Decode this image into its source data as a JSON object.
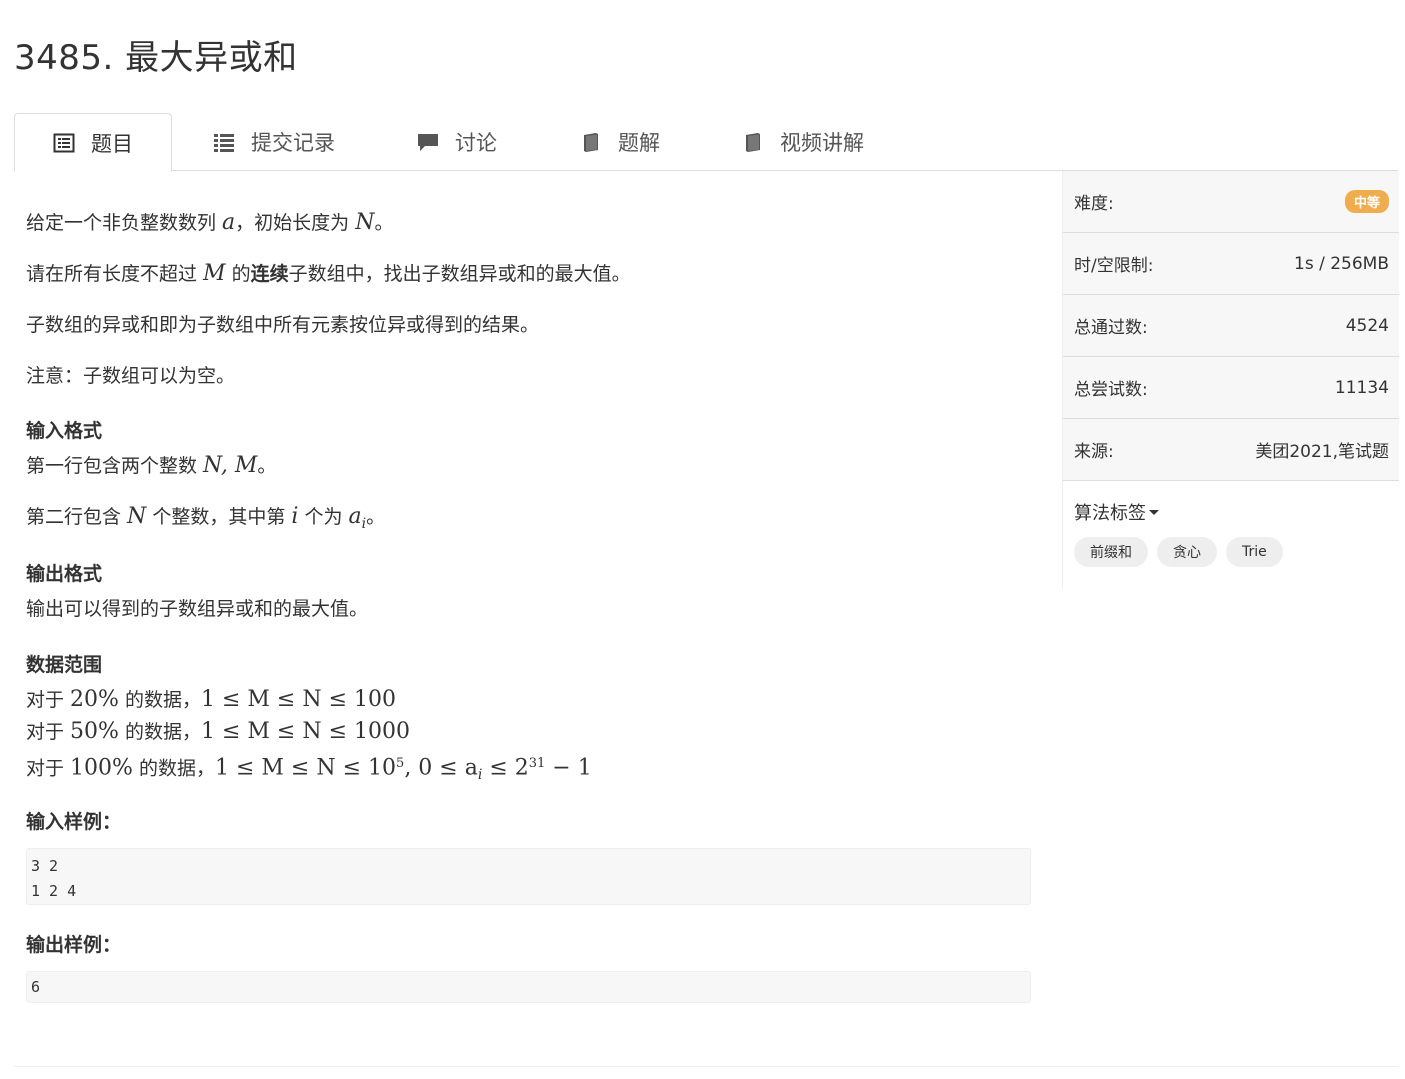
{
  "problem": {
    "title": "3485. 最大异或和"
  },
  "tabs": [
    {
      "label": "题目",
      "icon": "list-alt-icon"
    },
    {
      "label": "提交记录",
      "icon": "list-icon"
    },
    {
      "label": "讨论",
      "icon": "comment-icon"
    },
    {
      "label": "题解",
      "icon": "book-icon"
    },
    {
      "label": "视频讲解",
      "icon": "book-icon"
    }
  ],
  "content": {
    "p1_pre": "给定一个非负整数数列 ",
    "p1_var": "a",
    "p1_mid": "，初始长度为 ",
    "p1_var2": "N",
    "p1_end": "。",
    "p2_pre": "请在所有长度不超过 ",
    "p2_var": "M",
    "p2_mid": " 的",
    "p2_bold": "连续",
    "p2_end": "子数组中，找出子数组异或和的最大值。",
    "p3": "子数组的异或和即为子数组中所有元素按位异或得到的结果。",
    "p4": "注意：子数组可以为空。",
    "input_heading": "输入格式",
    "in1_pre": "第一行包含两个整数 ",
    "in1_var": "N, M",
    "in1_end": "。",
    "in2_pre": "第二行包含 ",
    "in2_var": "N",
    "in2_mid": " 个整数，其中第 ",
    "in2_var2": "i",
    "in2_mid2": " 个为 ",
    "in2_var3": "a",
    "in2_sub": "i",
    "in2_end": "。",
    "output_heading": "输出格式",
    "out1": "输出可以得到的子数组异或和的最大值。",
    "range_heading": "数据范围",
    "r1_pre": "对于 ",
    "r1_pct": "20%",
    "r1_mid": " 的数据，",
    "r1_expr": "1 ≤ M ≤ N ≤ 100",
    "r2_pre": "对于 ",
    "r2_pct": "50%",
    "r2_mid": " 的数据，",
    "r2_expr": "1 ≤ M ≤ N ≤ 1000",
    "r3_pre": "对于 ",
    "r3_pct": "100%",
    "r3_mid": " 的数据，",
    "r3_expr_a": "1 ≤ M ≤ N ≤ 10",
    "r3_sup1": "5",
    "r3_expr_b": ", 0 ≤ a",
    "r3_sub": "i",
    "r3_expr_c": " ≤ 2",
    "r3_sup2": "31",
    "r3_expr_d": " − 1",
    "sample_input_heading": "输入样例：",
    "sample_input": "3 2\n1 2 4",
    "sample_output_heading": "输出样例：",
    "sample_output": "6"
  },
  "sidebar": {
    "difficulty_label": "难度:",
    "difficulty_value": "中等",
    "limit_label": "时/空限制:",
    "limit_value": "1s / 256MB",
    "passed_label": "总通过数:",
    "passed_value": "4524",
    "tried_label": "总尝试数:",
    "tried_value": "11134",
    "source_label": "来源:",
    "source_value": "美团2021,笔试题",
    "tags_label": "算法标签",
    "tags": [
      "前缀和",
      "贪心",
      "Trie"
    ]
  },
  "colors": {
    "badge": "#f0ad4e",
    "panel_bg": "#f7f7f7"
  }
}
